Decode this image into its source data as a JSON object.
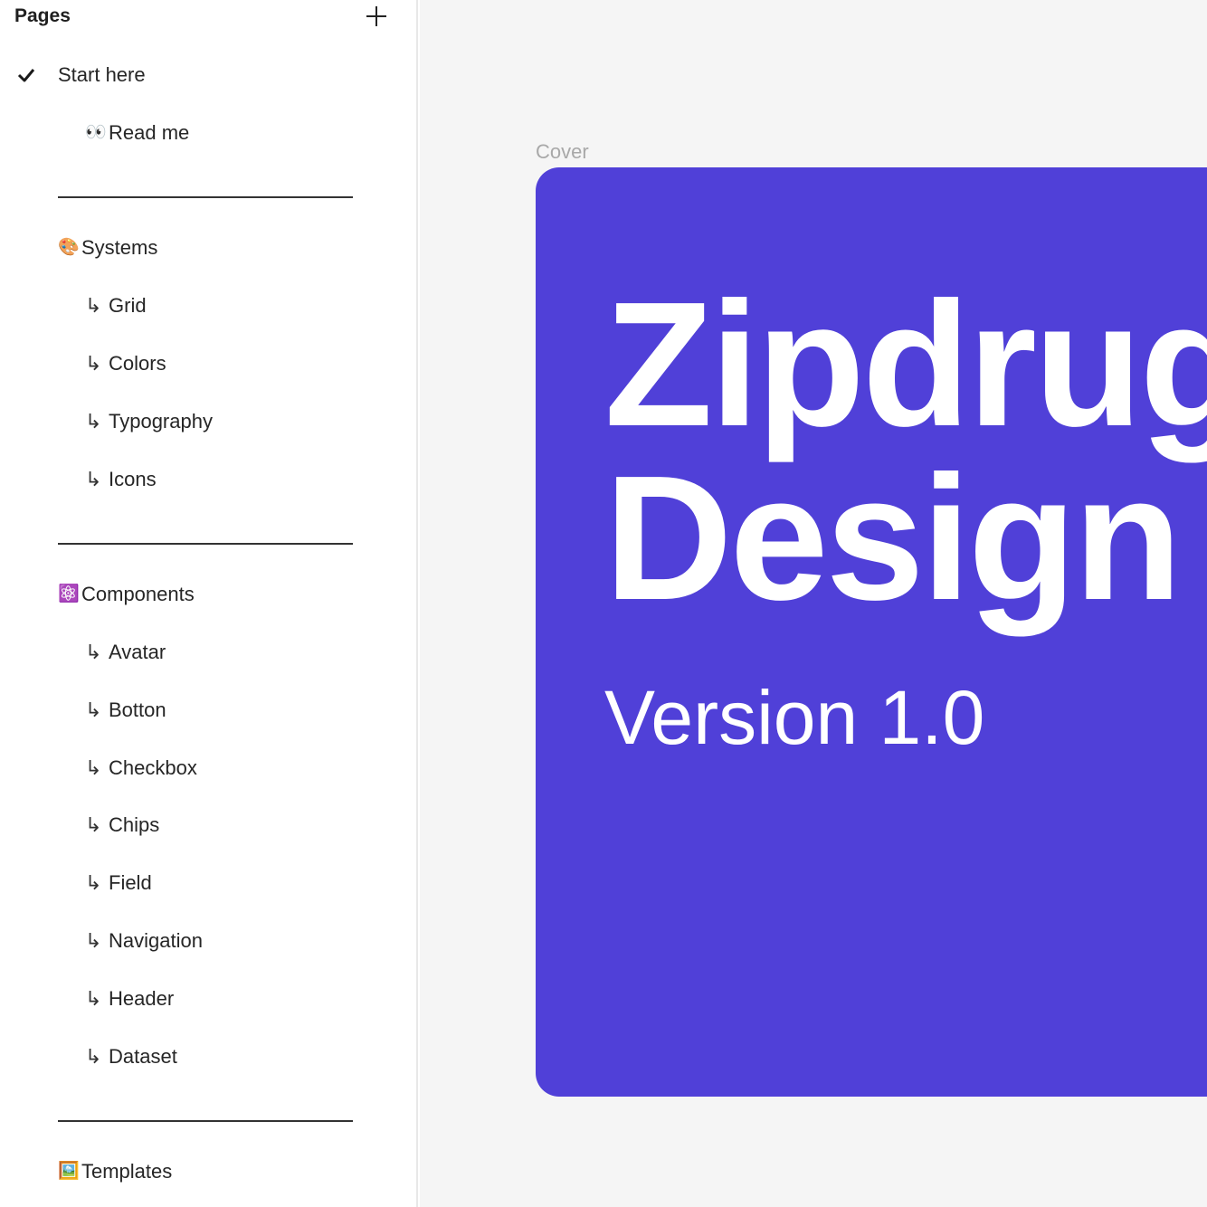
{
  "sidebar": {
    "title": "Pages",
    "items": [
      {
        "label": "Start here",
        "prefix": ""
      },
      {
        "label": "Read me",
        "prefix": "👀"
      },
      {
        "label": "Systems",
        "prefix": "🎨"
      },
      {
        "label": "Grid",
        "prefix": "↳"
      },
      {
        "label": "Colors",
        "prefix": "↳"
      },
      {
        "label": "Typography",
        "prefix": "↳"
      },
      {
        "label": "Icons",
        "prefix": "↳"
      },
      {
        "label": "Components",
        "prefix": "⚛️"
      },
      {
        "label": "Avatar",
        "prefix": "↳"
      },
      {
        "label": "Botton",
        "prefix": "↳"
      },
      {
        "label": "Checkbox",
        "prefix": "↳"
      },
      {
        "label": "Chips",
        "prefix": "↳"
      },
      {
        "label": "Field",
        "prefix": "↳"
      },
      {
        "label": "Navigation",
        "prefix": "↳"
      },
      {
        "label": "Header",
        "prefix": "↳"
      },
      {
        "label": "Dataset",
        "prefix": "↳"
      },
      {
        "label": "Templates",
        "prefix": "🖼️"
      }
    ],
    "selected": "Start here"
  },
  "canvas": {
    "frame_label": "Cover",
    "cover": {
      "title_line1": "Zipdrug",
      "title_line2": "Design S",
      "version": "Version 1.0"
    }
  },
  "colors": {
    "cover_bg": "#5040d8",
    "canvas_bg": "#f5f5f5",
    "divider": "#333333"
  },
  "icons": {
    "add": "plus-icon",
    "selected": "check-icon"
  }
}
